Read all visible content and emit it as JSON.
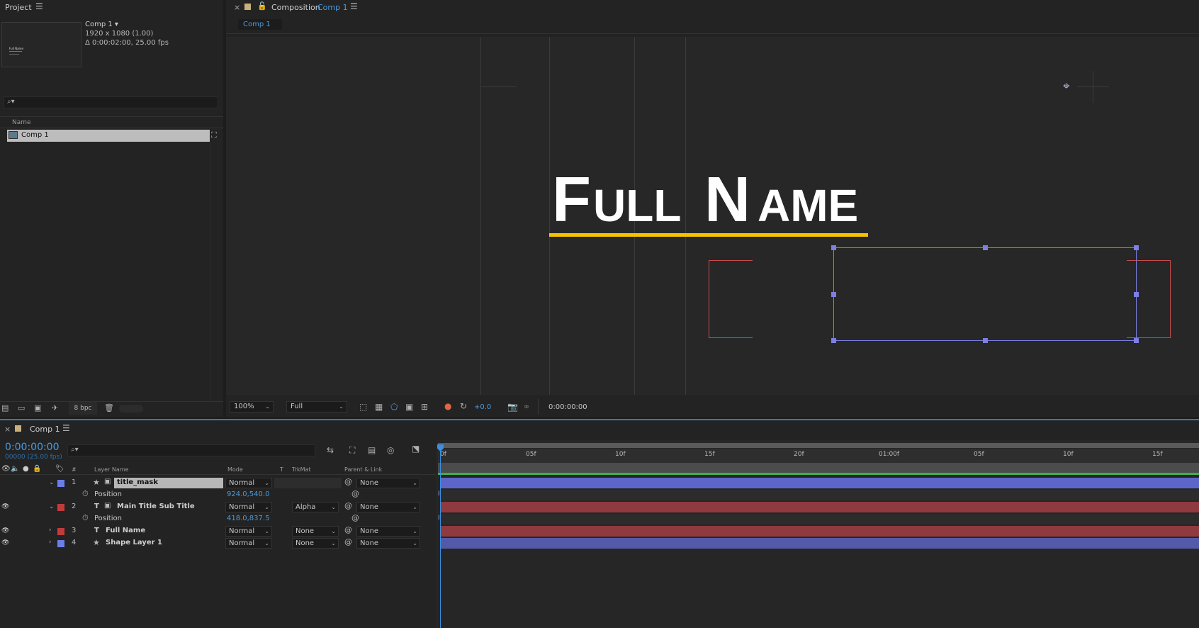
{
  "project": {
    "title": "Project",
    "comp_name": "Comp 1 ▾",
    "comp_res": "1920 x 1080 (1.00)",
    "comp_dur": "Δ 0:00:02:00, 25.00 fps",
    "thumb_text": "Full Name",
    "name_header": "Name",
    "item": "Comp 1",
    "bpc": "8 bpc"
  },
  "composition": {
    "close": "×",
    "label": "Composition",
    "comp_link": "Comp 1",
    "tab": "Comp 1",
    "title_text": "Full Name",
    "zoom": "100%",
    "resolution": "Full",
    "exposure": "+0.0",
    "timecode": "0:00:00:00",
    "accent_color": "#f5c400",
    "selection_color": "#7d7fe3",
    "mask_color": "#c84c4c"
  },
  "timeline": {
    "close": "×",
    "tab": "Comp 1",
    "timecode": "0:00:00:00",
    "frames": "00000 (25.00 fps)",
    "headers": {
      "num": "#",
      "layer_name": "Layer Name",
      "mode": "Mode",
      "t": "T",
      "trkmat": "TrkMat",
      "parent": "Parent & Link"
    },
    "ruler": [
      "0f",
      "05f",
      "10f",
      "15f",
      "20f",
      "01:00f",
      "05f",
      "10f",
      "15f"
    ],
    "layers": [
      {
        "num": "1",
        "name": "title_mask",
        "mode": "Normal",
        "trkmat": "",
        "parent": "None",
        "prop": "Position",
        "prop_value": "924.0,540.0",
        "color": "#6b7ee8"
      },
      {
        "num": "2",
        "name": "Main Title Sub Title",
        "mode": "Normal",
        "trkmat": "Alpha",
        "parent": "None",
        "prop": "Position",
        "prop_value": "418.0,837.5",
        "color": "#c23a3a"
      },
      {
        "num": "3",
        "name": "Full Name",
        "mode": "Normal",
        "trkmat": "None",
        "parent": "None",
        "color": "#c23a3a"
      },
      {
        "num": "4",
        "name": "Shape Layer 1",
        "mode": "Normal",
        "trkmat": "None",
        "parent": "None",
        "color": "#6b7ee8"
      }
    ]
  }
}
